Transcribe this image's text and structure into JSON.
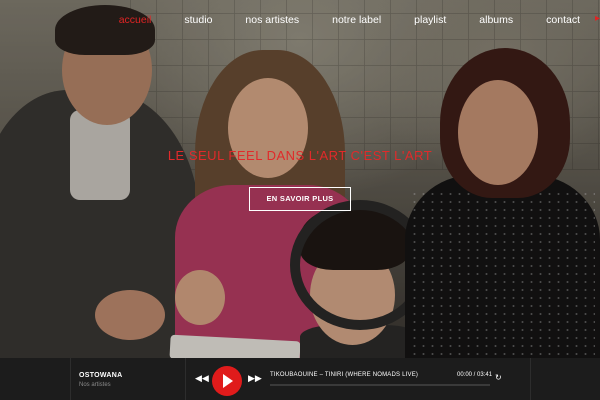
{
  "nav": {
    "items": [
      {
        "label": "accueil",
        "active": true
      },
      {
        "label": "studio",
        "active": false
      },
      {
        "label": "nos artistes",
        "active": false
      },
      {
        "label": "notre label",
        "active": false
      },
      {
        "label": "playlist",
        "active": false
      },
      {
        "label": "albums",
        "active": false
      },
      {
        "label": "contact",
        "active": false
      }
    ],
    "more_icon": "chevron-right-icon"
  },
  "hero": {
    "tagline": "LE SEUL FEEL DANS L'ART C'EST L'ART",
    "cta_label": "EN SAVOIR PLUS"
  },
  "player": {
    "title": "OSTOWANA",
    "subtitle": "Nos artistes",
    "track": "TIKOUBAOUINE – TINIRI (WHERE NOMADS LIVE)",
    "time": "00:00 / 03:41",
    "progress": 0,
    "icons": {
      "prev": "rewind-icon",
      "play": "play-icon",
      "next": "fast-forward-icon",
      "repeat": "repeat-icon"
    }
  },
  "colors": {
    "accent": "#e01b1b",
    "player_bg": "#1c1c1c",
    "nav_text": "#ffffff"
  }
}
